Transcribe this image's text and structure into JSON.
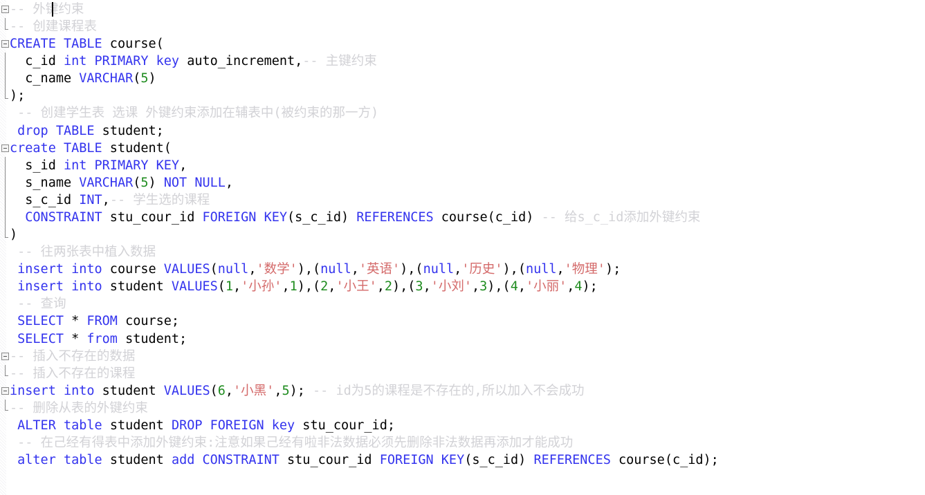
{
  "editor": {
    "kind": "sql-code-editor",
    "language": "SQL",
    "background_color": "#ffffff",
    "colors": {
      "keyword": "#3333ee",
      "number": "#1f8c1f",
      "string": "#d46a6a",
      "comment": "#d2d2d6",
      "plain": "#000000",
      "fold_marker": "#8a8a8a"
    },
    "caret": {
      "line": 1,
      "visible": true
    }
  },
  "lines": [
    {
      "n": 1,
      "fold": "start",
      "tokens": [
        {
          "t": "cmt",
          "s": "-- "
        },
        {
          "t": "cmt",
          "s": "外键约束"
        }
      ]
    },
    {
      "n": 2,
      "fold": "end",
      "tokens": [
        {
          "t": "cmt",
          "s": "-- "
        },
        {
          "t": "cmt",
          "s": "创建课程表"
        }
      ]
    },
    {
      "n": 3,
      "fold": "start",
      "tokens": [
        {
          "t": "kw",
          "s": "CREATE"
        },
        {
          "t": "plain",
          "s": " "
        },
        {
          "t": "kw",
          "s": "TABLE"
        },
        {
          "t": "plain",
          "s": " course("
        }
      ]
    },
    {
      "n": 4,
      "fold": "bar",
      "tokens": [
        {
          "t": "plain",
          "s": "  c_id "
        },
        {
          "t": "kw",
          "s": "int"
        },
        {
          "t": "plain",
          "s": " "
        },
        {
          "t": "kw",
          "s": "PRIMARY"
        },
        {
          "t": "plain",
          "s": " "
        },
        {
          "t": "kw",
          "s": "key"
        },
        {
          "t": "plain",
          "s": " auto_increment,"
        },
        {
          "t": "cmt",
          "s": "-- "
        },
        {
          "t": "cmt",
          "s": "主键约束"
        }
      ]
    },
    {
      "n": 5,
      "fold": "bar",
      "tokens": [
        {
          "t": "plain",
          "s": "  c_name "
        },
        {
          "t": "kw",
          "s": "VARCHAR"
        },
        {
          "t": "plain",
          "s": "("
        },
        {
          "t": "num",
          "s": "5"
        },
        {
          "t": "plain",
          "s": ")"
        }
      ]
    },
    {
      "n": 6,
      "fold": "end",
      "tokens": [
        {
          "t": "plain",
          "s": ");"
        }
      ]
    },
    {
      "n": 7,
      "fold": "none",
      "tokens": [
        {
          "t": "cmt",
          "s": " -- "
        },
        {
          "t": "cmt",
          "s": "创建学生表 选课 外键约束添加在辅表中(被约束的那一方)"
        }
      ]
    },
    {
      "n": 8,
      "fold": "none",
      "tokens": [
        {
          "t": "plain",
          "s": " "
        },
        {
          "t": "kw",
          "s": "drop"
        },
        {
          "t": "plain",
          "s": " "
        },
        {
          "t": "kw",
          "s": "TABLE"
        },
        {
          "t": "plain",
          "s": " student;"
        }
      ]
    },
    {
      "n": 9,
      "fold": "start",
      "tokens": [
        {
          "t": "kw",
          "s": "create"
        },
        {
          "t": "plain",
          "s": " "
        },
        {
          "t": "kw",
          "s": "TABLE"
        },
        {
          "t": "plain",
          "s": " student("
        }
      ]
    },
    {
      "n": 10,
      "fold": "bar",
      "tokens": [
        {
          "t": "plain",
          "s": "  s_id "
        },
        {
          "t": "kw",
          "s": "int"
        },
        {
          "t": "plain",
          "s": " "
        },
        {
          "t": "kw",
          "s": "PRIMARY"
        },
        {
          "t": "plain",
          "s": " "
        },
        {
          "t": "kw",
          "s": "KEY"
        },
        {
          "t": "plain",
          "s": ","
        }
      ]
    },
    {
      "n": 11,
      "fold": "bar",
      "tokens": [
        {
          "t": "plain",
          "s": "  s_name "
        },
        {
          "t": "kw",
          "s": "VARCHAR"
        },
        {
          "t": "plain",
          "s": "("
        },
        {
          "t": "num",
          "s": "5"
        },
        {
          "t": "plain",
          "s": ") "
        },
        {
          "t": "kw",
          "s": "NOT"
        },
        {
          "t": "plain",
          "s": " "
        },
        {
          "t": "kw",
          "s": "NULL"
        },
        {
          "t": "plain",
          "s": ","
        }
      ]
    },
    {
      "n": 12,
      "fold": "bar",
      "tokens": [
        {
          "t": "plain",
          "s": "  s_c_id "
        },
        {
          "t": "kw",
          "s": "INT"
        },
        {
          "t": "plain",
          "s": ","
        },
        {
          "t": "cmt",
          "s": "-- "
        },
        {
          "t": "cmt",
          "s": "学生选的课程"
        }
      ]
    },
    {
      "n": 13,
      "fold": "bar",
      "tokens": [
        {
          "t": "plain",
          "s": "  "
        },
        {
          "t": "kw",
          "s": "CONSTRAINT"
        },
        {
          "t": "plain",
          "s": " stu_cour_id "
        },
        {
          "t": "kw",
          "s": "FOREIGN"
        },
        {
          "t": "plain",
          "s": " "
        },
        {
          "t": "kw",
          "s": "KEY"
        },
        {
          "t": "plain",
          "s": "(s_c_id) "
        },
        {
          "t": "kw",
          "s": "REFERENCES"
        },
        {
          "t": "plain",
          "s": " course(c_id) "
        },
        {
          "t": "cmt",
          "s": "-- "
        },
        {
          "t": "cmt",
          "s": "给s_c_id添加外键约束"
        }
      ]
    },
    {
      "n": 14,
      "fold": "end",
      "tokens": [
        {
          "t": "plain",
          "s": ")"
        }
      ]
    },
    {
      "n": 15,
      "fold": "none",
      "tokens": [
        {
          "t": "cmt",
          "s": " -- "
        },
        {
          "t": "cmt",
          "s": "往两张表中植入数据"
        }
      ]
    },
    {
      "n": 16,
      "fold": "none",
      "tokens": [
        {
          "t": "plain",
          "s": " "
        },
        {
          "t": "kw",
          "s": "insert"
        },
        {
          "t": "plain",
          "s": " "
        },
        {
          "t": "kw",
          "s": "into"
        },
        {
          "t": "plain",
          "s": " course "
        },
        {
          "t": "kw",
          "s": "VALUES"
        },
        {
          "t": "plain",
          "s": "("
        },
        {
          "t": "kw",
          "s": "null"
        },
        {
          "t": "plain",
          "s": ","
        },
        {
          "t": "str",
          "s": "'数学'"
        },
        {
          "t": "plain",
          "s": "),("
        },
        {
          "t": "kw",
          "s": "null"
        },
        {
          "t": "plain",
          "s": ","
        },
        {
          "t": "str",
          "s": "'英语'"
        },
        {
          "t": "plain",
          "s": "),("
        },
        {
          "t": "kw",
          "s": "null"
        },
        {
          "t": "plain",
          "s": ","
        },
        {
          "t": "str",
          "s": "'历史'"
        },
        {
          "t": "plain",
          "s": "),("
        },
        {
          "t": "kw",
          "s": "null"
        },
        {
          "t": "plain",
          "s": ","
        },
        {
          "t": "str",
          "s": "'物理'"
        },
        {
          "t": "plain",
          "s": ");"
        }
      ]
    },
    {
      "n": 17,
      "fold": "none",
      "tokens": [
        {
          "t": "plain",
          "s": " "
        },
        {
          "t": "kw",
          "s": "insert"
        },
        {
          "t": "plain",
          "s": " "
        },
        {
          "t": "kw",
          "s": "into"
        },
        {
          "t": "plain",
          "s": " student "
        },
        {
          "t": "kw",
          "s": "VALUES"
        },
        {
          "t": "plain",
          "s": "("
        },
        {
          "t": "num",
          "s": "1"
        },
        {
          "t": "plain",
          "s": ","
        },
        {
          "t": "str",
          "s": "'小孙'"
        },
        {
          "t": "plain",
          "s": ","
        },
        {
          "t": "num",
          "s": "1"
        },
        {
          "t": "plain",
          "s": "),("
        },
        {
          "t": "num",
          "s": "2"
        },
        {
          "t": "plain",
          "s": ","
        },
        {
          "t": "str",
          "s": "'小王'"
        },
        {
          "t": "plain",
          "s": ","
        },
        {
          "t": "num",
          "s": "2"
        },
        {
          "t": "plain",
          "s": "),("
        },
        {
          "t": "num",
          "s": "3"
        },
        {
          "t": "plain",
          "s": ","
        },
        {
          "t": "str",
          "s": "'小刘'"
        },
        {
          "t": "plain",
          "s": ","
        },
        {
          "t": "num",
          "s": "3"
        },
        {
          "t": "plain",
          "s": "),("
        },
        {
          "t": "num",
          "s": "4"
        },
        {
          "t": "plain",
          "s": ","
        },
        {
          "t": "str",
          "s": "'小丽'"
        },
        {
          "t": "plain",
          "s": ","
        },
        {
          "t": "num",
          "s": "4"
        },
        {
          "t": "plain",
          "s": ");"
        }
      ]
    },
    {
      "n": 18,
      "fold": "none",
      "tokens": [
        {
          "t": "cmt",
          "s": " -- "
        },
        {
          "t": "cmt",
          "s": "查询"
        }
      ]
    },
    {
      "n": 19,
      "fold": "none",
      "tokens": [
        {
          "t": "plain",
          "s": " "
        },
        {
          "t": "kw",
          "s": "SELECT"
        },
        {
          "t": "plain",
          "s": " * "
        },
        {
          "t": "kw",
          "s": "FROM"
        },
        {
          "t": "plain",
          "s": " course;"
        }
      ]
    },
    {
      "n": 20,
      "fold": "none",
      "tokens": [
        {
          "t": "plain",
          "s": " "
        },
        {
          "t": "kw",
          "s": "SELECT"
        },
        {
          "t": "plain",
          "s": " * "
        },
        {
          "t": "kw",
          "s": "from"
        },
        {
          "t": "plain",
          "s": " student;"
        }
      ]
    },
    {
      "n": 21,
      "fold": "start",
      "tokens": [
        {
          "t": "cmt",
          "s": "-- "
        },
        {
          "t": "cmt",
          "s": "插入不存在的数据"
        }
      ]
    },
    {
      "n": 22,
      "fold": "end",
      "tokens": [
        {
          "t": "cmt",
          "s": "-- "
        },
        {
          "t": "cmt",
          "s": "插入不存在的课程"
        }
      ]
    },
    {
      "n": 23,
      "fold": "start",
      "tokens": [
        {
          "t": "kw",
          "s": "insert"
        },
        {
          "t": "plain",
          "s": " "
        },
        {
          "t": "kw",
          "s": "into"
        },
        {
          "t": "plain",
          "s": " student "
        },
        {
          "t": "kw",
          "s": "VALUES"
        },
        {
          "t": "plain",
          "s": "("
        },
        {
          "t": "num",
          "s": "6"
        },
        {
          "t": "plain",
          "s": ","
        },
        {
          "t": "str",
          "s": "'小黑'"
        },
        {
          "t": "plain",
          "s": ","
        },
        {
          "t": "num",
          "s": "5"
        },
        {
          "t": "plain",
          "s": "); "
        },
        {
          "t": "cmt",
          "s": "-- "
        },
        {
          "t": "cmt",
          "s": "id为5的课程是不存在的,所以加入不会成功"
        }
      ]
    },
    {
      "n": 24,
      "fold": "end",
      "tokens": [
        {
          "t": "cmt",
          "s": "-- "
        },
        {
          "t": "cmt",
          "s": "删除从表的外键约束"
        }
      ]
    },
    {
      "n": 25,
      "fold": "none",
      "tokens": [
        {
          "t": "plain",
          "s": " "
        },
        {
          "t": "kw",
          "s": "ALTER"
        },
        {
          "t": "plain",
          "s": " "
        },
        {
          "t": "kw",
          "s": "table"
        },
        {
          "t": "plain",
          "s": " student "
        },
        {
          "t": "kw",
          "s": "DROP"
        },
        {
          "t": "plain",
          "s": " "
        },
        {
          "t": "kw",
          "s": "FOREIGN"
        },
        {
          "t": "plain",
          "s": " "
        },
        {
          "t": "kw",
          "s": "key"
        },
        {
          "t": "plain",
          "s": " stu_cour_id;"
        }
      ]
    },
    {
      "n": 26,
      "fold": "none",
      "tokens": [
        {
          "t": "cmt",
          "s": " -- "
        },
        {
          "t": "cmt",
          "s": "在己经有得表中添加外键约束:注意如果己经有啦非法数据必须先删除非法数据再添加才能成功"
        }
      ]
    },
    {
      "n": 27,
      "fold": "none",
      "tokens": [
        {
          "t": "plain",
          "s": " "
        },
        {
          "t": "kw",
          "s": "alter"
        },
        {
          "t": "plain",
          "s": " "
        },
        {
          "t": "kw",
          "s": "table"
        },
        {
          "t": "plain",
          "s": " student "
        },
        {
          "t": "kw",
          "s": "add"
        },
        {
          "t": "plain",
          "s": " "
        },
        {
          "t": "kw",
          "s": "CONSTRAINT"
        },
        {
          "t": "plain",
          "s": " stu_cour_id "
        },
        {
          "t": "kw",
          "s": "FOREIGN"
        },
        {
          "t": "plain",
          "s": " "
        },
        {
          "t": "kw",
          "s": "KEY"
        },
        {
          "t": "plain",
          "s": "(s_c_id) "
        },
        {
          "t": "kw",
          "s": "REFERENCES"
        },
        {
          "t": "plain",
          "s": " course(c_id);"
        }
      ]
    }
  ]
}
